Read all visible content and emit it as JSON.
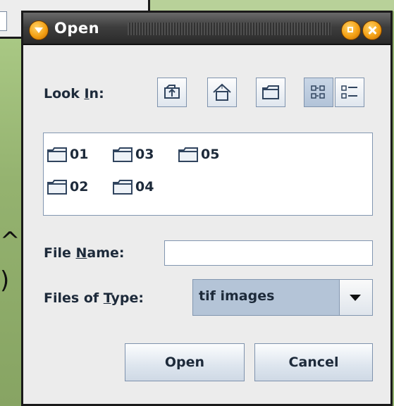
{
  "dialog": {
    "title": "Open",
    "look_in_label_pre": "Look ",
    "look_in_label_u": "I",
    "look_in_label_post": "n:",
    "file_name_label_pre": "File ",
    "file_name_label_u": "N",
    "file_name_label_post": "ame:",
    "files_of_type_label_pre": "Files of ",
    "files_of_type_label_u": "T",
    "files_of_type_label_post": "ype:",
    "file_name_value": "",
    "file_type_selected": "tif images",
    "open_button": "Open",
    "cancel_button": "Cancel"
  },
  "toolbar": {
    "icons": [
      "up-one-level-icon",
      "home-icon",
      "new-folder-icon",
      "list-view-icon",
      "details-view-icon"
    ]
  },
  "files": [
    {
      "name": "01"
    },
    {
      "name": "03"
    },
    {
      "name": "05"
    },
    {
      "name": "02"
    },
    {
      "name": "04"
    }
  ],
  "background": {
    "glyph_top": "^",
    "glyph_bottom": ")"
  },
  "colors": {
    "accent": "#f3a014",
    "selection": "#b4c4d7",
    "desktop": "#8fae6a"
  }
}
